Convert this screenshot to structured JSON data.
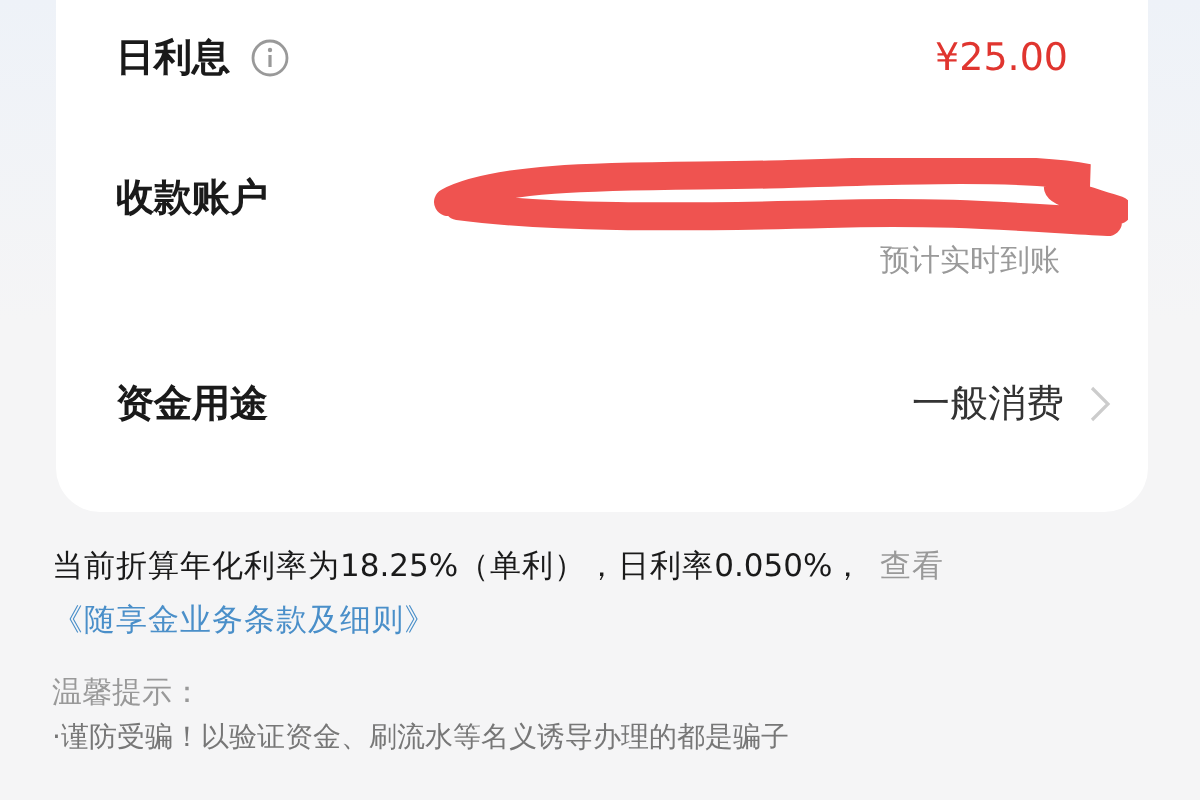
{
  "card": {
    "rows": [
      {
        "kind": "amount",
        "label": "日利息",
        "value": "¥25.00"
      },
      {
        "kind": "account",
        "label": "收款账户",
        "sub": "预计实时到账"
      },
      {
        "kind": "select",
        "label": "资金用途",
        "value": "一般消费"
      }
    ]
  },
  "rate_note": {
    "text": "当前折算年化利率为18.25%（单利），日利率0.050%，",
    "view": "查看",
    "link": "《随享金业务条款及细则》"
  },
  "tips": {
    "title": "温馨提示：",
    "line": "·谨防受骗！以验证资金、刷流水等名义诱导办理的都是骗子"
  }
}
